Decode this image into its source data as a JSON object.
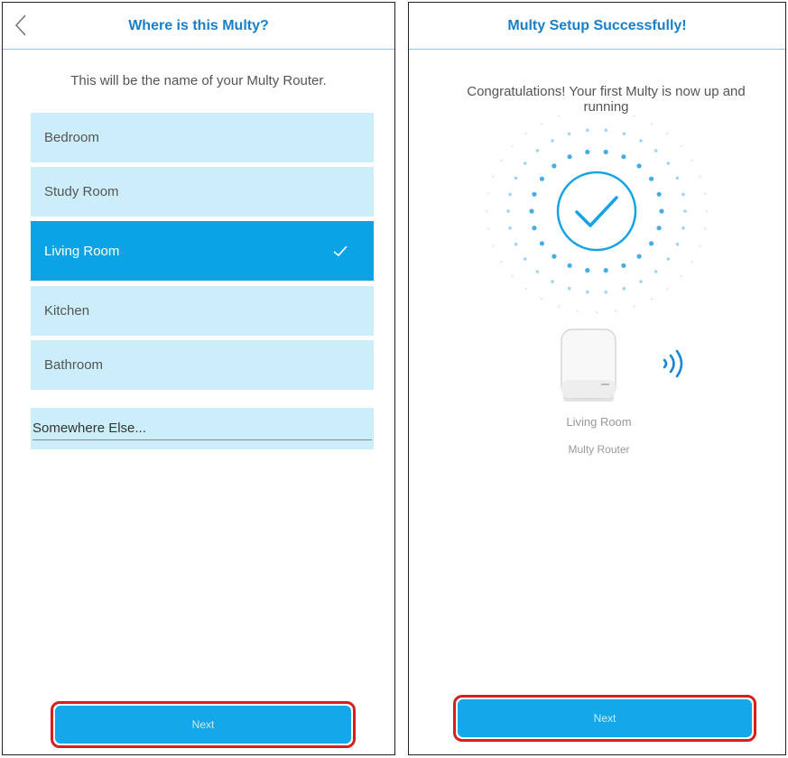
{
  "left_screen": {
    "header": {
      "title": "Where is this Multy?",
      "back_icon": "chevron-left-icon"
    },
    "subtitle": "This will be the name of your Multy Router.",
    "rooms": [
      {
        "label": "Bedroom",
        "selected": false
      },
      {
        "label": "Study Room",
        "selected": false
      },
      {
        "label": "Living Room",
        "selected": true
      },
      {
        "label": "Kitchen",
        "selected": false
      },
      {
        "label": "Bathroom",
        "selected": false
      }
    ],
    "other_field": {
      "value": "",
      "placeholder": "Somewhere Else..."
    },
    "next_label": "Next"
  },
  "right_screen": {
    "header": {
      "title": "Multy Setup Successfully!"
    },
    "congrats": "Congratulations! Your first Multy is now up and running",
    "device": {
      "name": "Living Room",
      "type": "Multy Router"
    },
    "next_label": "Next"
  },
  "colors": {
    "accent": "#0aa3e6",
    "title": "#1a7fc9",
    "list_bg": "#cbeefa",
    "highlight_border": "#d62020"
  }
}
